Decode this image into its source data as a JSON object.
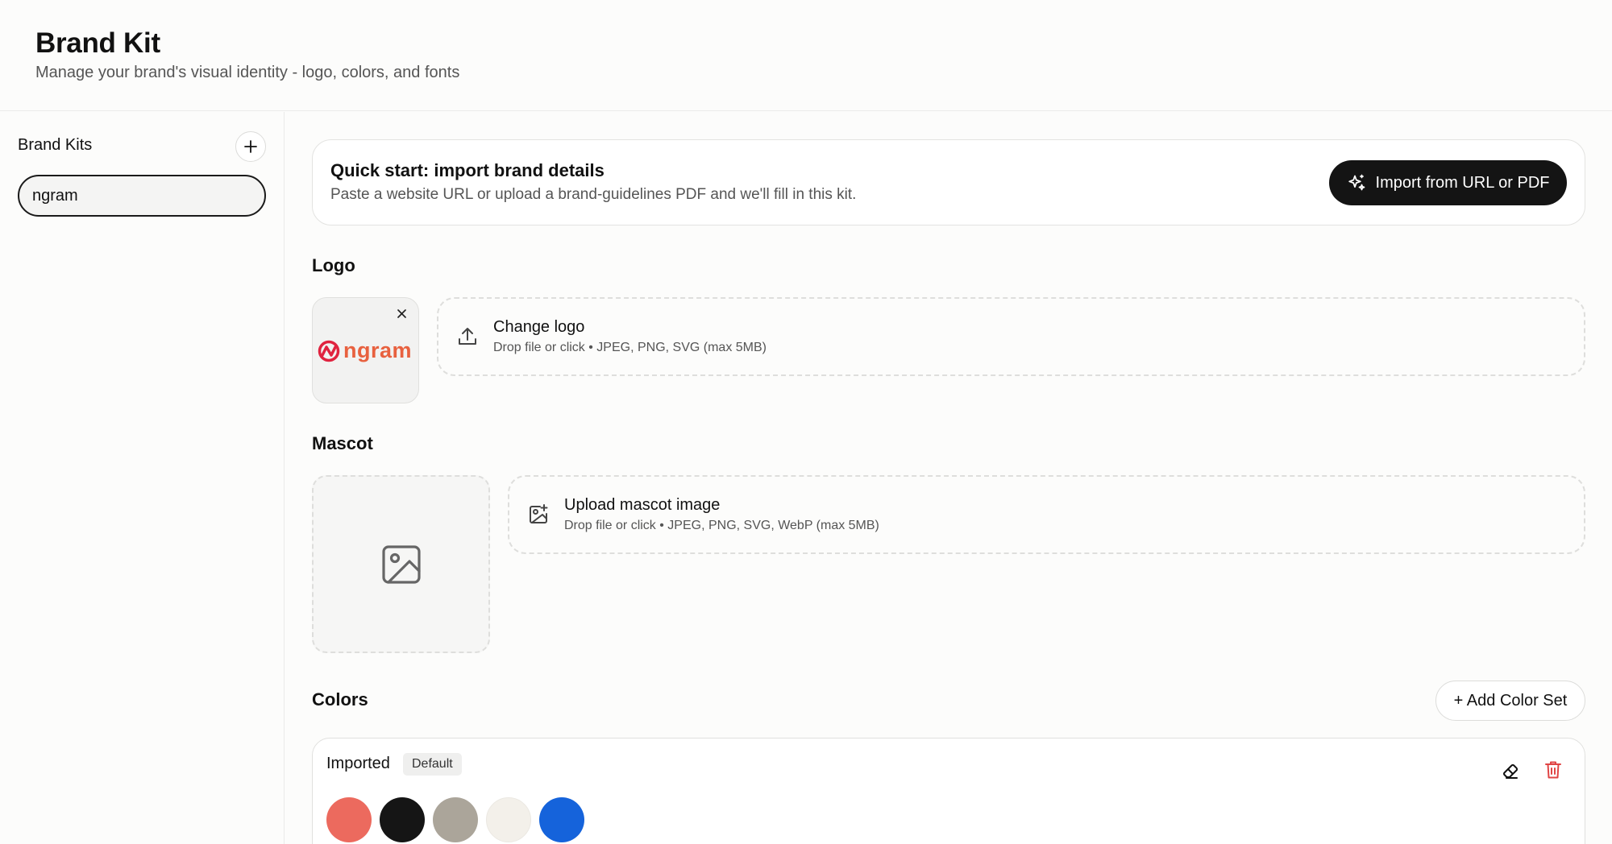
{
  "header": {
    "title": "Brand Kit",
    "subtitle": "Manage your brand's visual identity - logo, colors, and fonts"
  },
  "sidebar": {
    "title": "Brand Kits",
    "add_icon": "plus-icon",
    "items": [
      {
        "label": "ngram",
        "selected": true
      }
    ]
  },
  "quick_start": {
    "title": "Quick start: import brand details",
    "description": "Paste a website URL or upload a brand-guidelines PDF and we'll fill in this kit.",
    "button_label": "Import from URL or PDF",
    "button_icon": "sparkles-icon"
  },
  "logo": {
    "section_title": "Logo",
    "current_logo_text": "ngram",
    "remove_icon": "close-icon",
    "upload_icon": "upload-icon",
    "upload_title": "Change logo",
    "upload_hint": "Drop file or click • JPEG, PNG, SVG (max 5MB)"
  },
  "mascot": {
    "section_title": "Mascot",
    "placeholder_icon": "image-icon",
    "upload_icon": "image-plus-icon",
    "upload_title": "Upload mascot image",
    "upload_hint": "Drop file or click • JPEG, PNG, SVG, WebP (max 5MB)"
  },
  "colors": {
    "section_title": "Colors",
    "add_button_label": "+ Add Color Set",
    "sets": [
      {
        "name": "Imported",
        "badge": "Default",
        "swatches": [
          "#ec6a5e",
          "#151515",
          "#aba59a",
          "#f3f0ea",
          "#1563db"
        ]
      }
    ]
  },
  "theme": {
    "accent": "#141414",
    "logo_brand": "#e8613f",
    "logo_mark": "#e0233f",
    "danger": "#e04545"
  }
}
